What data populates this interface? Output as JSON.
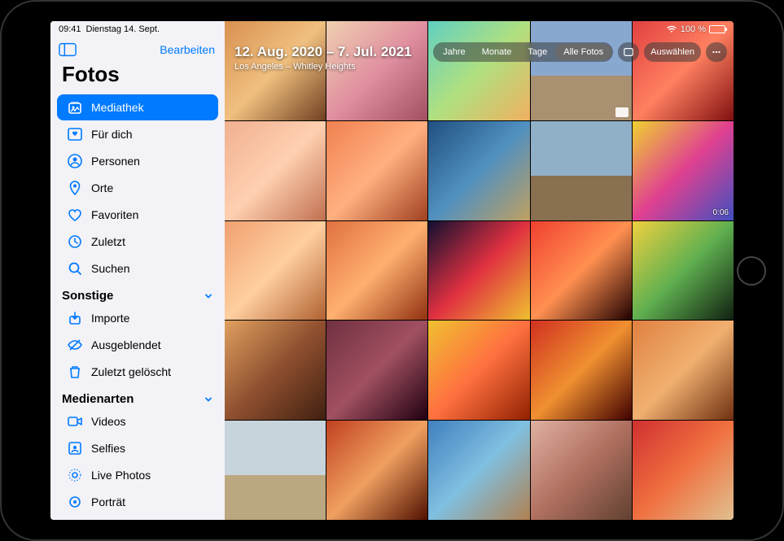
{
  "status": {
    "time": "09:41",
    "date": "Dienstag 14. Sept.",
    "wifi_icon": "wifi-icon",
    "battery_pct": "100 %"
  },
  "sidebar": {
    "edit": "Bearbeiten",
    "title": "Fotos",
    "items": [
      {
        "icon": "library-icon",
        "label": "Mediathek",
        "active": true
      },
      {
        "icon": "for-you-icon",
        "label": "Für dich"
      },
      {
        "icon": "people-icon",
        "label": "Personen"
      },
      {
        "icon": "places-icon",
        "label": "Orte"
      },
      {
        "icon": "heart-icon",
        "label": "Favoriten"
      },
      {
        "icon": "clock-icon",
        "label": "Zuletzt"
      },
      {
        "icon": "search-icon",
        "label": "Suchen"
      }
    ],
    "section_other": "Sonstige",
    "other_items": [
      {
        "icon": "import-icon",
        "label": "Importe"
      },
      {
        "icon": "hidden-icon",
        "label": "Ausgeblendet"
      },
      {
        "icon": "trash-icon",
        "label": "Zuletzt gelöscht"
      }
    ],
    "section_media": "Medienarten",
    "media_items": [
      {
        "icon": "video-icon",
        "label": "Videos"
      },
      {
        "icon": "selfie-icon",
        "label": "Selfies"
      },
      {
        "icon": "live-icon",
        "label": "Live Photos"
      },
      {
        "icon": "portrait-icon",
        "label": "Porträt"
      }
    ]
  },
  "grid_header": {
    "date_range": "12. Aug. 2020 – 7. Jul. 2021",
    "location": "Los Angeles – Whitley Heights"
  },
  "segments": [
    "Jahre",
    "Monate",
    "Tage",
    "Alle Fotos"
  ],
  "segment_active": 3,
  "select_label": "Auswählen",
  "video_duration": "0:06"
}
